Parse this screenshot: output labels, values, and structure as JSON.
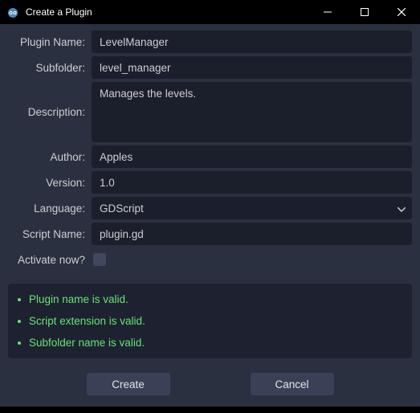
{
  "window": {
    "title": "Create a Plugin"
  },
  "form": {
    "plugin_name": {
      "label": "Plugin Name:",
      "value": "LevelManager"
    },
    "subfolder": {
      "label": "Subfolder:",
      "value": "level_manager"
    },
    "description": {
      "label": "Description:",
      "value": "Manages the levels."
    },
    "author": {
      "label": "Author:",
      "value": "Apples"
    },
    "version": {
      "label": "Version:",
      "value": "1.0"
    },
    "language": {
      "label": "Language:",
      "value": "GDScript"
    },
    "script_name": {
      "label": "Script Name:",
      "value": "plugin.gd"
    },
    "activate": {
      "label": "Activate now?",
      "checked": false
    }
  },
  "validation": {
    "0": "Plugin name is valid.",
    "1": "Script extension is valid.",
    "2": "Subfolder name is valid."
  },
  "buttons": {
    "create": "Create",
    "cancel": "Cancel"
  }
}
